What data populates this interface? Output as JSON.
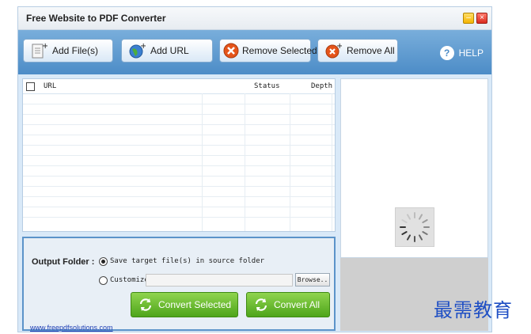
{
  "window": {
    "title": "Free Website to PDF Converter"
  },
  "toolbar": {
    "add_files_label": "Add File(s)",
    "add_url_label": "Add URL",
    "remove_selected_label": "Remove Selected",
    "remove_all_label": "Remove All",
    "help_label": "HELP",
    "help_symbol": "?"
  },
  "list": {
    "columns": [
      "URL",
      "Status",
      "Depth"
    ],
    "rows": []
  },
  "output": {
    "label": "Output Folder :",
    "option_source": "Save target file(s) in source folder",
    "option_customize": "Customize",
    "custom_path_value": "",
    "browse_label": "Browse..",
    "selected_option": "source"
  },
  "actions": {
    "convert_selected_label": "Convert Selected",
    "convert_all_label": "Convert All"
  },
  "footer": {
    "link": "www.freepdfsolutions.com"
  },
  "watermark": {
    "text": "最需教育"
  },
  "colors": {
    "toolbar": "#4c8cc7",
    "convert_button": "#4ea51b",
    "remove_icon": "#e5541a",
    "link": "#1f3fb5"
  },
  "icons": {
    "add_files": "document-plus-icon",
    "add_url": "globe-plus-icon",
    "remove_selected": "red-x-icon",
    "remove_all": "red-x-plus-icon",
    "help": "question-circle-icon",
    "convert": "refresh-arrows-icon",
    "preview": "loading-spinner-icon"
  }
}
